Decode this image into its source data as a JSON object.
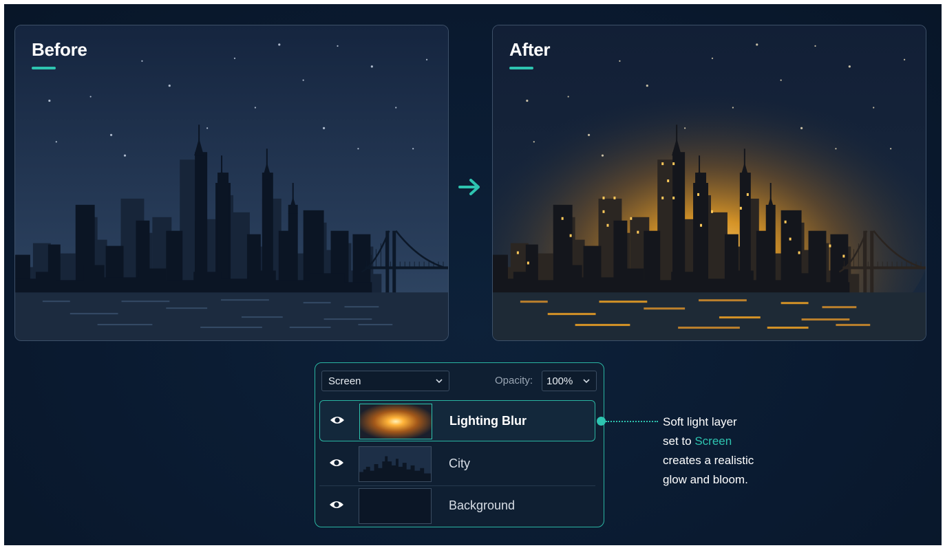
{
  "before_panel": {
    "title": "Before"
  },
  "after_panel": {
    "title": "After"
  },
  "layers_panel": {
    "blend_mode": "Screen",
    "opacity_label": "Opacity:",
    "opacity_value": "100%",
    "layers": [
      {
        "name": "Lighting Blur",
        "selected": true,
        "visible": true,
        "thumbnail": "orange-glow"
      },
      {
        "name": "City",
        "selected": false,
        "visible": true,
        "thumbnail": "city-skyline"
      },
      {
        "name": "Background",
        "selected": false,
        "visible": true,
        "thumbnail": "dark-fill"
      }
    ]
  },
  "callout": {
    "line1": "Soft light layer",
    "line2_prefix": "set to ",
    "line2_accent": "Screen",
    "line3": "creates a realistic",
    "line4": "glow and bloom."
  },
  "colors": {
    "background": "#0a1a30",
    "accent": "#2ec4b0",
    "glow": "#f6a623",
    "panel_border": "#3d5068"
  },
  "icons": [
    "arrow-right-icon",
    "eye-icon",
    "chevron-down-icon"
  ]
}
